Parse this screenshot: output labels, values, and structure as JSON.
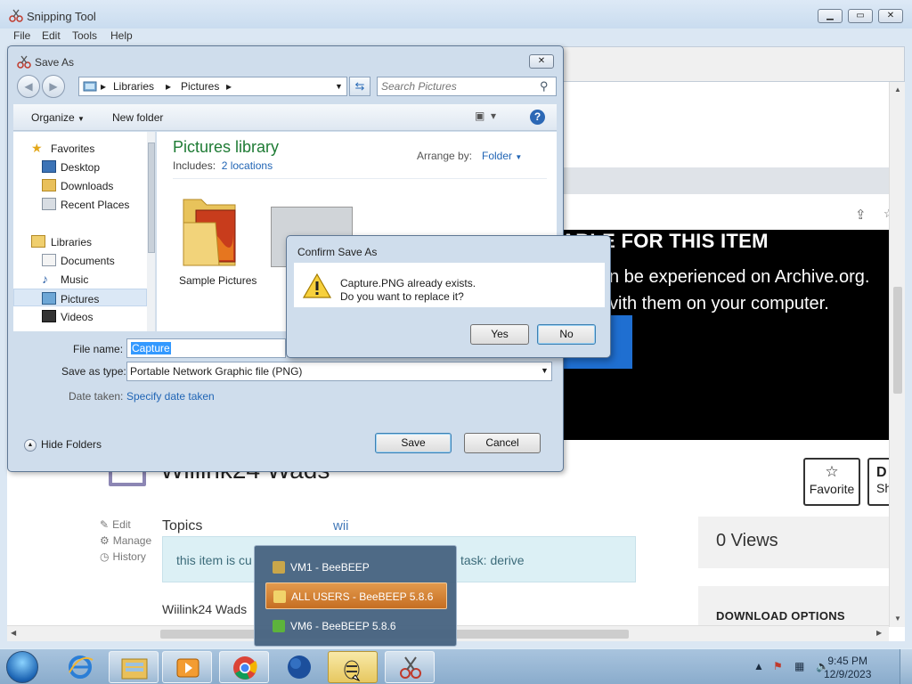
{
  "snipping_tool": {
    "title": "Snipping Tool",
    "menu": [
      "File",
      "Edit",
      "Tools",
      "Help"
    ],
    "window_buttons": {
      "minimize": "▁",
      "maximize": "▭",
      "close": "✕"
    }
  },
  "captured_page": {
    "banner_heading": "ABLE FOR THIS ITEM",
    "banner_line1": "n be experienced on Archive.org.",
    "banner_line2": "vith them on your computer.",
    "item_title": "Wiilink24 Wads",
    "favorite_label": "Favorite",
    "share_letter": "D",
    "share_label": "Sh",
    "side_links": [
      "Edit",
      "Manage",
      "History"
    ],
    "topics_label": "Topics",
    "topics_value": "wii",
    "info_text_left": "this item is cu",
    "info_text_right": "task: derive",
    "views": "0 Views",
    "download_options": "DOWNLOAD OPTIONS",
    "description_line": "Wiilink24 Wads"
  },
  "save_as": {
    "title": "Save As",
    "address": [
      "Libraries",
      "Pictures"
    ],
    "search_placeholder": "Search Pictures",
    "organize": "Organize",
    "new_folder": "New folder",
    "nav": {
      "favorites": "Favorites",
      "desktop": "Desktop",
      "downloads": "Downloads",
      "recent_places": "Recent Places",
      "libraries": "Libraries",
      "documents": "Documents",
      "music": "Music",
      "pictures": "Pictures",
      "videos": "Videos"
    },
    "library_title": "Pictures library",
    "includes_label": "Includes:",
    "includes_link": "2 locations",
    "arrange_by": "Arrange by:",
    "arrange_value": "Folder",
    "folder_name": "Sample Pictures",
    "file_name_label": "File name:",
    "file_name_value": "Capture",
    "save_type_label": "Save as type:",
    "save_type_value": "Portable Network Graphic file (PNG)",
    "date_taken_label": "Date taken:",
    "date_taken_link": "Specify date taken",
    "hide_folders": "Hide Folders",
    "save_button": "Save",
    "cancel_button": "Cancel"
  },
  "confirm": {
    "title": "Confirm Save As",
    "message_line1": "Capture.PNG already exists.",
    "message_line2": "Do you want to replace it?",
    "yes": "Yes",
    "no": "No"
  },
  "jump_list": {
    "items": [
      {
        "label": "VM1 - BeeBEEP",
        "active": false
      },
      {
        "label": "ALL USERS - BeeBEEP 5.8.6",
        "active": true
      },
      {
        "label": "VM6 - BeeBEEP 5.8.6",
        "active": false
      }
    ]
  },
  "taskbar": {
    "time": "9:45 PM",
    "date": "12/9/2023",
    "items": [
      "internet-explorer-icon",
      "file-explorer-icon",
      "media-player-icon",
      "chrome-icon",
      "globe-icon",
      "beebeep-icon",
      "snipping-tool-icon"
    ]
  },
  "colors": {
    "title_green": "#1e7b34",
    "link_blue": "#2165b5",
    "jump_active": "#c56e22",
    "selection_blue": "#3399ff"
  }
}
